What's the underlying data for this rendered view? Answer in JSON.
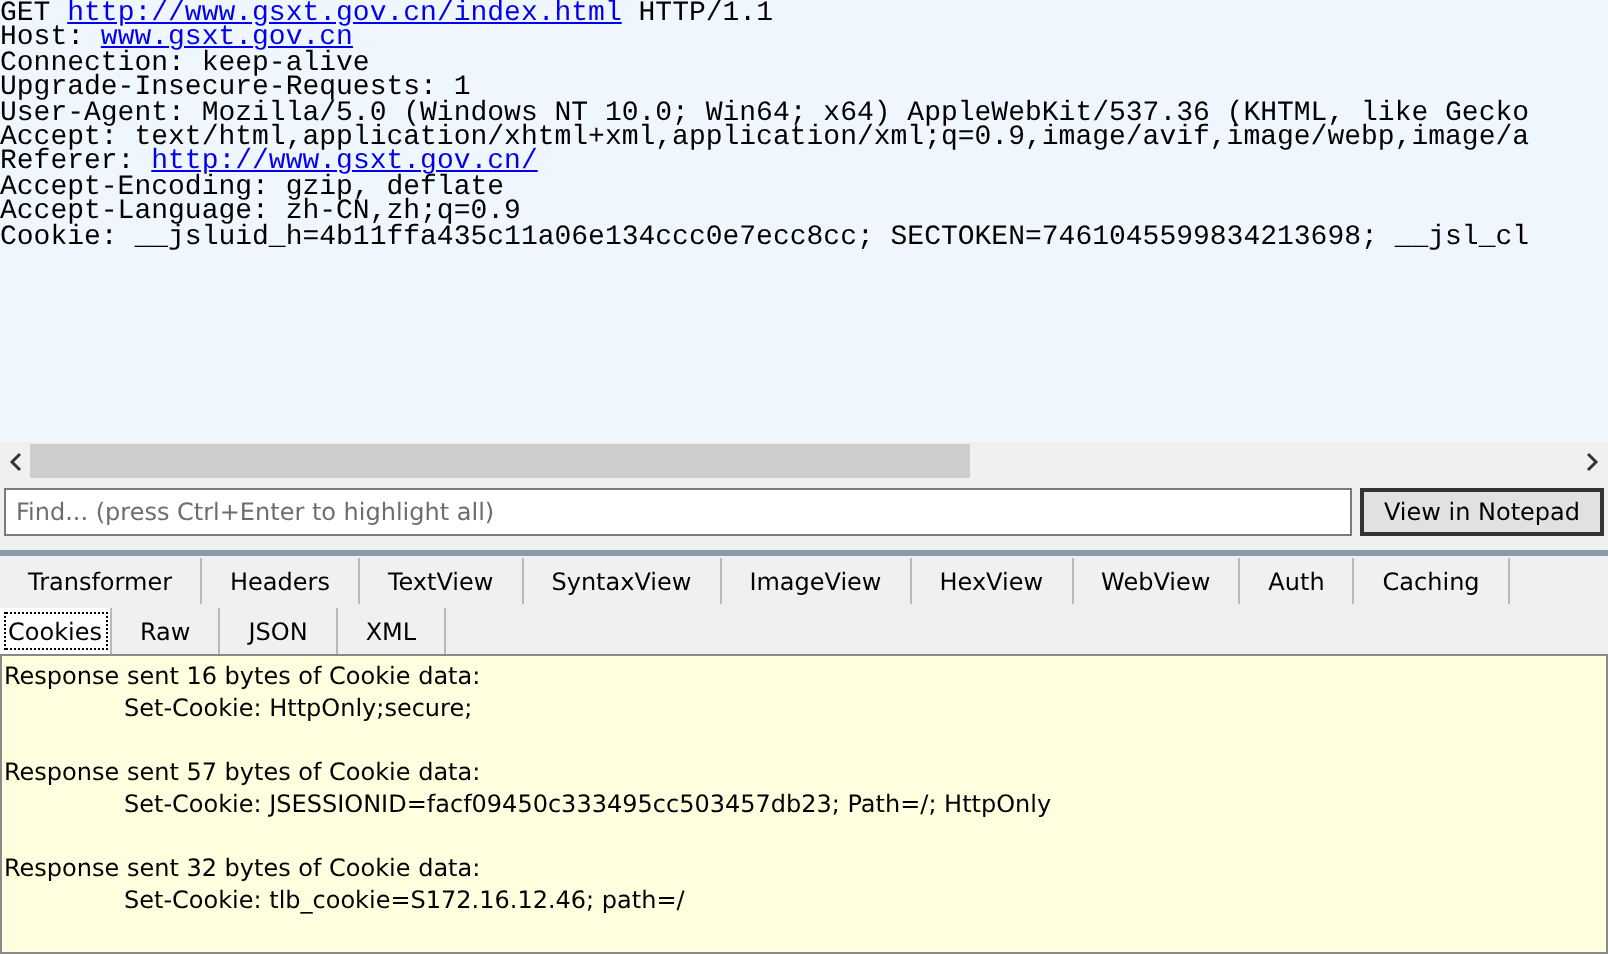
{
  "request": {
    "lines": [
      [
        {
          "text": "GET ",
          "link": false
        },
        {
          "text": "http://www.gsxt.gov.cn/index.html",
          "link": true
        },
        {
          "text": " HTTP/1.1",
          "link": false
        }
      ],
      [
        {
          "text": "Host: ",
          "link": false
        },
        {
          "text": "www.gsxt.gov.cn",
          "link": true
        }
      ],
      [
        {
          "text": "Connection: keep-alive",
          "link": false
        }
      ],
      [
        {
          "text": "Upgrade-Insecure-Requests: 1",
          "link": false
        }
      ],
      [
        {
          "text": "User-Agent: Mozilla/5.0 (Windows NT 10.0; Win64; x64) AppleWebKit/537.36 (KHTML, like Gecko",
          "link": false
        }
      ],
      [
        {
          "text": "Accept: text/html,application/xhtml+xml,application/xml;q=0.9,image/avif,image/webp,image/a",
          "link": false
        }
      ],
      [
        {
          "text": "Referer: ",
          "link": false
        },
        {
          "text": "http://www.gsxt.gov.cn/",
          "link": true
        }
      ],
      [
        {
          "text": "Accept-Encoding: gzip, deflate",
          "link": false
        }
      ],
      [
        {
          "text": "Accept-Language: zh-CN,zh;q=0.9",
          "link": false
        }
      ],
      [
        {
          "text": "Cookie: __jsluid_h=4b11ffa435c11a06e134ccc0e7ecc8cc; SECTOKEN=7461045599834213698; __jsl_cl",
          "link": false
        }
      ]
    ]
  },
  "find": {
    "placeholder": "Find... (press Ctrl+Enter to highlight all)",
    "button": "View in Notepad"
  },
  "tab_rows": [
    [
      {
        "label": "Transformer",
        "selected": false
      },
      {
        "label": "Headers",
        "selected": false
      },
      {
        "label": "TextView",
        "selected": false
      },
      {
        "label": "SyntaxView",
        "selected": false
      },
      {
        "label": "ImageView",
        "selected": false
      },
      {
        "label": "HexView",
        "selected": false
      },
      {
        "label": "WebView",
        "selected": false
      },
      {
        "label": "Auth",
        "selected": false
      },
      {
        "label": "Caching",
        "selected": false
      }
    ],
    [
      {
        "label": "Cookies",
        "selected": true
      },
      {
        "label": "Raw",
        "selected": false
      },
      {
        "label": "JSON",
        "selected": false
      },
      {
        "label": "XML",
        "selected": false
      }
    ]
  ],
  "response": [
    {
      "summary": "Response sent 16 bytes of Cookie data:",
      "detail": "Set-Cookie: HttpOnly;secure;"
    },
    {
      "summary": "Response sent 57 bytes of Cookie data:",
      "detail": "Set-Cookie: JSESSIONID=facf09450c333495cc503457db23; Path=/; HttpOnly"
    },
    {
      "summary": "Response sent 32 bytes of Cookie data:",
      "detail": "Set-Cookie: tlb_cookie=S172.16.12.46; path=/"
    }
  ]
}
